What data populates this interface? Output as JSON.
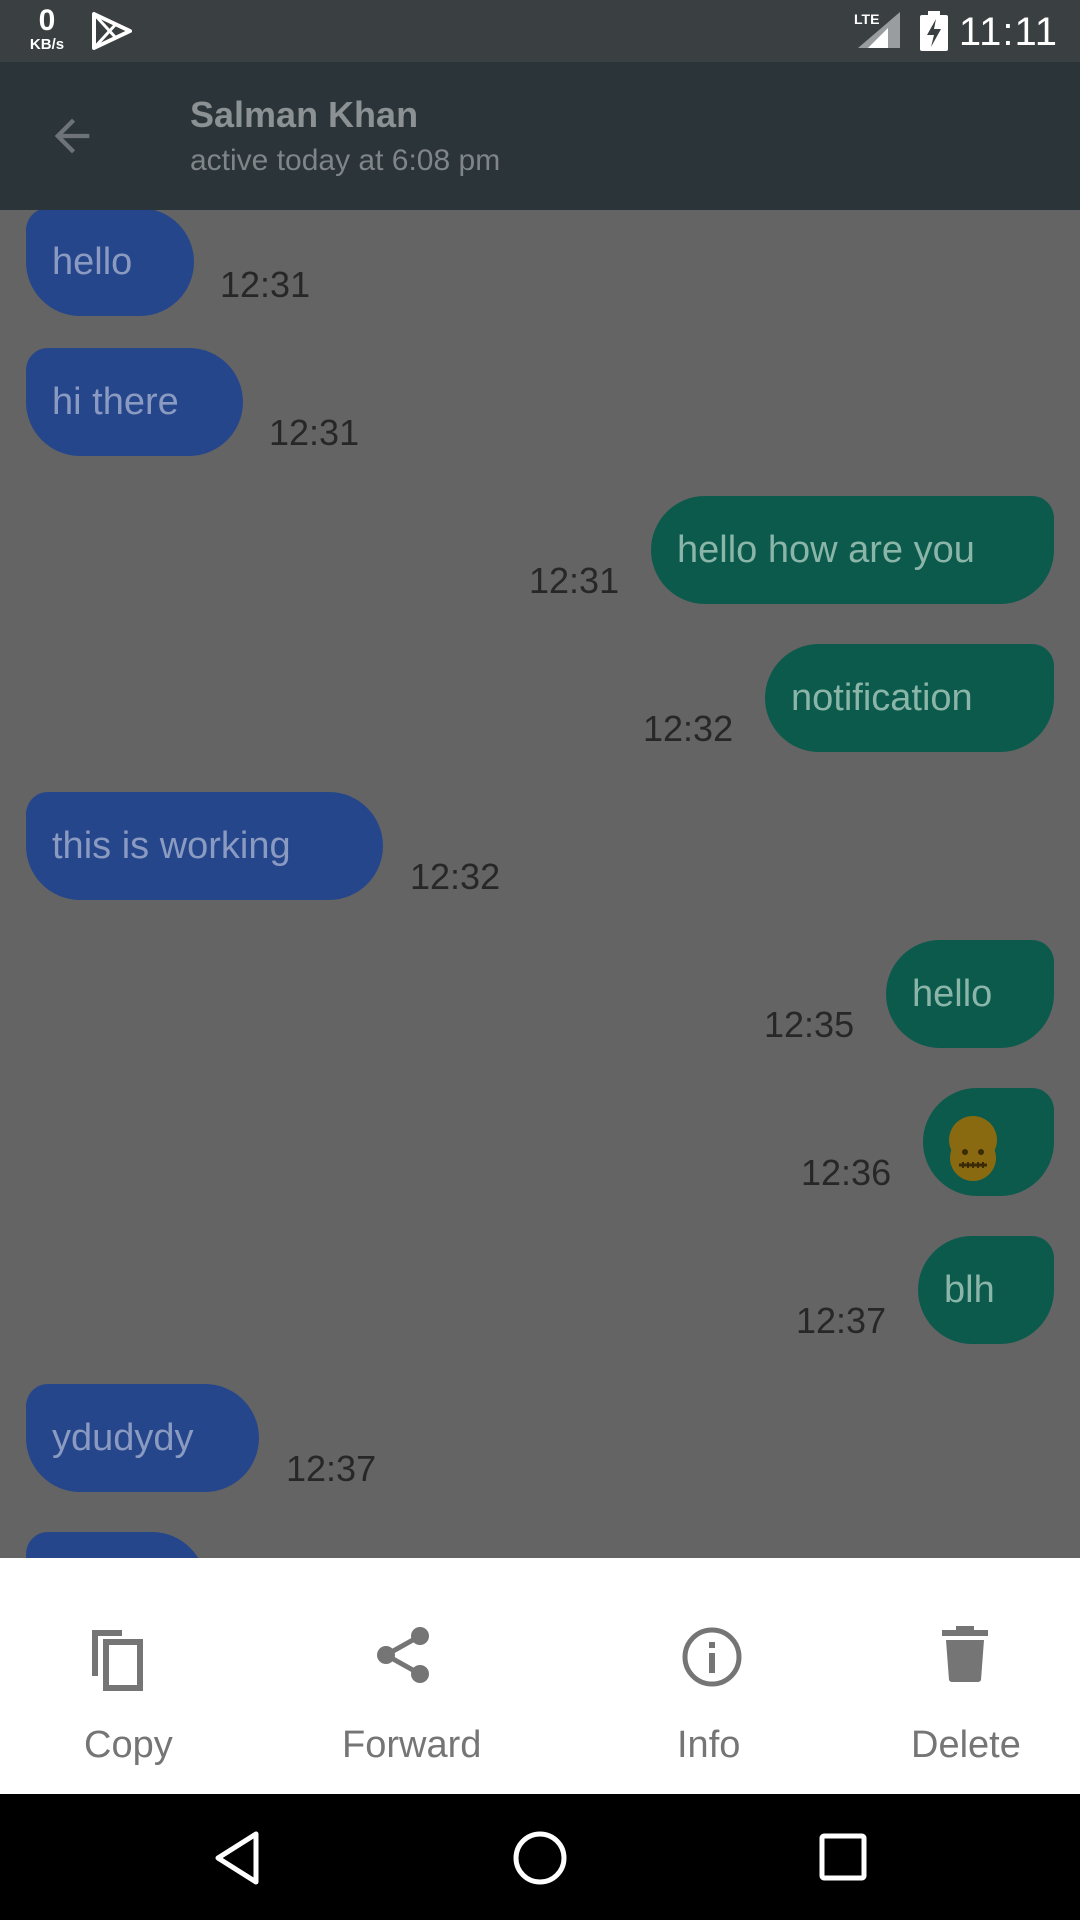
{
  "status_bar": {
    "net_speed_value": "0",
    "net_speed_unit": "KB/s",
    "network_type": "LTE",
    "time": "11:11",
    "icons": [
      "play-store-icon",
      "lte-signal-icon",
      "battery-charging-icon"
    ]
  },
  "app_bar": {
    "contact_name": "Salman Khan",
    "contact_status": "active today at 6:08 pm",
    "back_icon": "arrow-back-icon"
  },
  "messages": [
    {
      "direction": "incoming",
      "text": "hello",
      "time": "12:31"
    },
    {
      "direction": "incoming",
      "text": "hi there",
      "time": "12:31"
    },
    {
      "direction": "outgoing",
      "text": "hello how are you",
      "time": "12:31"
    },
    {
      "direction": "outgoing",
      "text": "notification",
      "time": "12:32"
    },
    {
      "direction": "incoming",
      "text": "this is working",
      "time": "12:32"
    },
    {
      "direction": "outgoing",
      "text": "hello",
      "time": "12:35"
    },
    {
      "direction": "outgoing",
      "text": "🤐",
      "time": "12:36"
    },
    {
      "direction": "outgoing",
      "text": "blh",
      "time": "12:37"
    },
    {
      "direction": "incoming",
      "text": "ydudydy",
      "time": "12:37"
    }
  ],
  "actions": [
    {
      "label": "Copy",
      "icon": "copy-icon"
    },
    {
      "label": "Forward",
      "icon": "share-icon"
    },
    {
      "label": "Info",
      "icon": "info-icon"
    },
    {
      "label": "Delete",
      "icon": "trash-icon"
    }
  ],
  "nav_bar": {
    "icons": [
      "nav-back-icon",
      "nav-home-icon",
      "nav-recents-icon"
    ]
  },
  "colors": {
    "incoming_bubble": "#26468b",
    "outgoing_bubble": "#0b5a4c",
    "app_bar": "#2b3439",
    "scrim_background": "#646464"
  }
}
